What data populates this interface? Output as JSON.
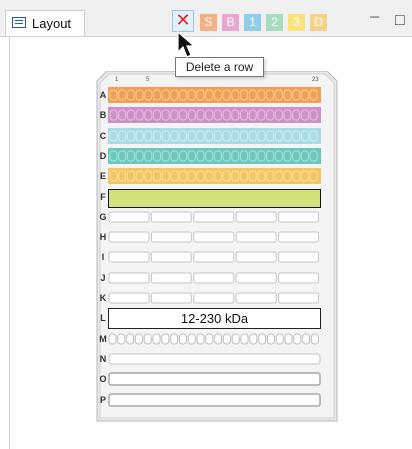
{
  "tab": {
    "label": "Layout",
    "icon": "layout-icon"
  },
  "toolbar": {
    "delete_row": {
      "glyph": "✕",
      "icon": "delete-row-icon"
    },
    "buttons": [
      {
        "label": "S",
        "color": "#f4b183"
      },
      {
        "label": "B",
        "color": "#e8a6d4"
      },
      {
        "label": "1",
        "color": "#8fcfeb"
      },
      {
        "label": "2",
        "color": "#a8dcc0"
      },
      {
        "label": "3",
        "color": "#f7e37a"
      },
      {
        "label": "D",
        "color": "#f7d08a"
      }
    ],
    "minimize": "─",
    "maximize": "□"
  },
  "tooltip": {
    "text": "Delete a row"
  },
  "plate": {
    "column_labels": [
      "1",
      "5",
      "",
      "",
      "",
      "23"
    ],
    "rows": [
      {
        "label": "A",
        "color": "#f0a050",
        "pattern": "wells"
      },
      {
        "label": "B",
        "color": "#cf8fc9",
        "pattern": "wells"
      },
      {
        "label": "C",
        "color": "#a9dbe6",
        "pattern": "wells"
      },
      {
        "label": "D",
        "color": "#6cc7bd",
        "pattern": "wells"
      },
      {
        "label": "E",
        "color": "#f5c560",
        "pattern": "wells"
      },
      {
        "label": "F",
        "color": "#d4e07a",
        "pattern": "selected"
      },
      {
        "label": "G",
        "color": "#ffffff",
        "pattern": "blocks"
      },
      {
        "label": "H",
        "color": "#ffffff",
        "pattern": "blocks"
      },
      {
        "label": "I",
        "color": "#ffffff",
        "pattern": "blocks"
      },
      {
        "label": "J",
        "color": "#ffffff",
        "pattern": "blocks"
      },
      {
        "label": "K",
        "color": "#ffffff",
        "pattern": "blocks"
      },
      {
        "label": "L",
        "color": "#ffffff",
        "pattern": "text",
        "text": "12-230 kDa"
      },
      {
        "label": "M",
        "color": "#ffffff",
        "pattern": "smallwells"
      },
      {
        "label": "N",
        "color": "#ffffff",
        "pattern": "plain"
      },
      {
        "label": "O",
        "color": "#ffffff",
        "pattern": "bar"
      },
      {
        "label": "P",
        "color": "#ffffff",
        "pattern": "bar"
      }
    ]
  }
}
